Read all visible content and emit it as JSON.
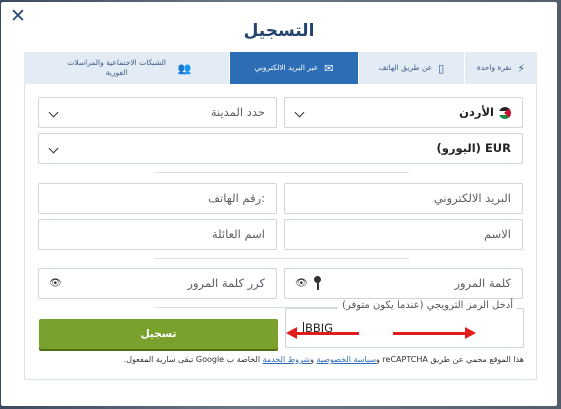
{
  "modal": {
    "title": "التسجيل",
    "close_glyph": "✕"
  },
  "tabs": [
    {
      "label": "نقرة واحدة",
      "icon": "lightning-icon",
      "glyph": "⚡",
      "active": false
    },
    {
      "label": "عن طريق الهاتف",
      "icon": "phone-icon",
      "glyph": "▯",
      "active": false
    },
    {
      "label": "عبر البريد الالكتروني",
      "icon": "envelope-icon",
      "glyph": "✉",
      "active": true
    },
    {
      "label": "الشبكات الاجتماعية والمراسلات الفورية",
      "icon": "users-icon",
      "glyph": "👥",
      "active": false
    }
  ],
  "form": {
    "country": {
      "value": "الأردن",
      "icon": "jordan-flag-icon"
    },
    "city": {
      "placeholder": "حدد المدينة"
    },
    "currency": {
      "value": "EUR (اليورو)"
    },
    "email": {
      "placeholder": "البريد الالكتروني"
    },
    "phone": {
      "placeholder": ":رقم الهاتف"
    },
    "first_name": {
      "placeholder": "الاسم"
    },
    "last_name": {
      "placeholder": "اسم العائلة"
    },
    "password": {
      "placeholder": "كلمة المرور",
      "icons": [
        "key-icon",
        "eye-slash-icon"
      ]
    },
    "password_repeat": {
      "placeholder": "كرر كلمة المرور",
      "icons": [
        "eye-slash-icon"
      ]
    },
    "promo": {
      "legend": "أدخل الرمز الترويجي (عندما يكون متوفر)",
      "value": "BBIG"
    },
    "submit_label": "تسجيل"
  },
  "annotations": {
    "arrow_color": "#e01c1c"
  },
  "footer": {
    "text_before": "هذا الموقع محمي عن طريق reCAPTCHA و",
    "privacy_link": "سياسة الخصوصية",
    "and": " و",
    "terms_link": "شروط الخدمة",
    "text_after": " الخاصة ب Google تبقى سارية المفعول."
  },
  "colors": {
    "accent": "#2d6db5",
    "title": "#24436e",
    "submit": "#7aa12e",
    "tab_bg": "#e3ecf5"
  }
}
